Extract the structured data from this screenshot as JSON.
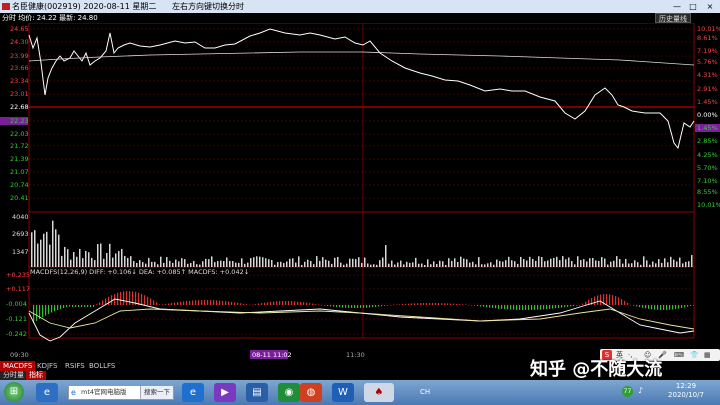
{
  "window": {
    "title": "名臣健康(002919) 2020-08-11 星期二",
    "hint": "左右方向键切换分时",
    "minimize": "—",
    "maximize": "□",
    "close": "×"
  },
  "info_bar": {
    "text": "分时 均价: 24.22 最新: 24.80",
    "history_button": "历史量线"
  },
  "price_axis": {
    "left_labels": [
      "24.65",
      "24.30",
      "23.99",
      "23.66",
      "23.34",
      "23.01",
      "22.68",
      "22.23",
      "22.03",
      "21.72",
      "21.39",
      "21.07",
      "20.74",
      "20.41"
    ],
    "right_labels": [
      "10.01%",
      "8.61%",
      "7.19%",
      "5.76%",
      "4.31%",
      "2.91%",
      "1.45%",
      "0.00%",
      "1.45%",
      "2.85%",
      "4.25%",
      "5.70%",
      "7.10%",
      "8.55%",
      "10.01%"
    ],
    "highlight_label": "22.23",
    "highlight_pct": "1.88%"
  },
  "volume_axis": {
    "labels": [
      "4040",
      "2693",
      "1347"
    ]
  },
  "macd_panel": {
    "header": "MACDFS(12,26,9) DIFF: +0.106↓ DEA: +0.085↑ MACDFS: +0.042↓",
    "labels": [
      "+0.235",
      "+0.117",
      "-0.004",
      "-0.121",
      "-0.242"
    ]
  },
  "time_axis": {
    "start": "09:30",
    "mid": "11:30",
    "cursor": "08-11 11:02"
  },
  "indicator_tabs": [
    "MACDFS",
    "KDJFS",
    "RSIFS",
    "BOLLFS"
  ],
  "status_row": {
    "left": "分时量",
    "right": "指标"
  },
  "taskbar": {
    "search_text": "mt4官网电脑版",
    "search_button": "搜索一下",
    "clock_time": "12:29",
    "clock_date": "2020/10/7",
    "ime": "CH"
  },
  "watermark": "知乎 @不随大流",
  "colors": {
    "accent_red": "#c00000",
    "grid_red": "#8b0000",
    "up_bar": "#e03030",
    "down_bar": "#30c030",
    "line_white": "#ffffff",
    "highlight_bg": "#7a1f9a"
  }
}
